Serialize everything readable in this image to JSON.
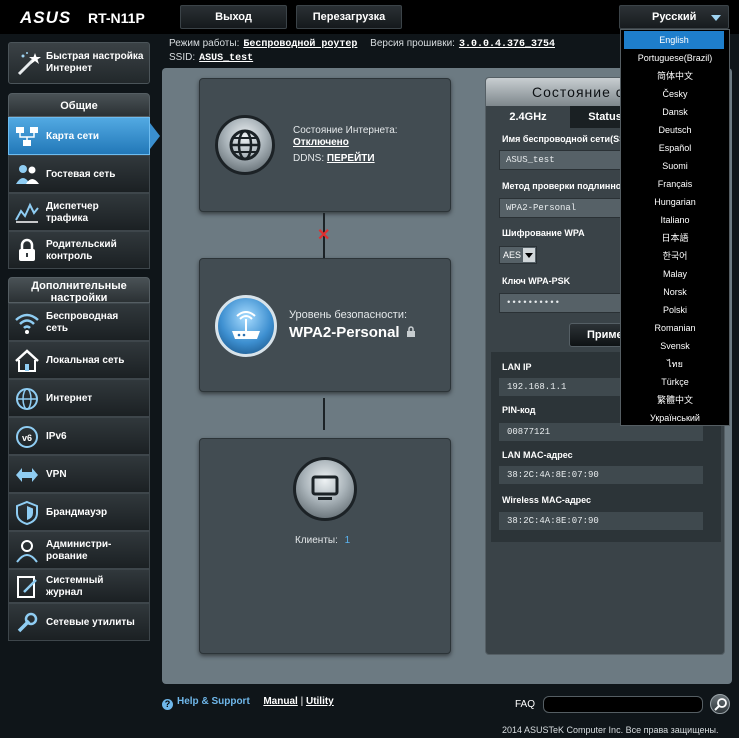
{
  "header": {
    "brand": "ASUS",
    "model": "RT-N11P",
    "logout_label": "Выход",
    "reboot_label": "Перезагрузка",
    "language_selected": "Русский"
  },
  "info": {
    "mode_label": "Режим работы:",
    "mode_value": "Беспроводной роутер",
    "firmware_label": "Версия прошивки:",
    "firmware_value": "3.0.0.4.376_3754",
    "ssid_label": "SSID:",
    "ssid_value": "ASUS_test"
  },
  "sidebar": {
    "quick_setup_line1": "Быстрая настройка",
    "quick_setup_line2": "Интернет",
    "general_header": "Общие",
    "general_items": [
      {
        "label1": "Карта сети",
        "label2": ""
      },
      {
        "label1": "Гостевая сеть",
        "label2": ""
      },
      {
        "label1": "Диспетчер",
        "label2": "трафика"
      },
      {
        "label1": "Родительский",
        "label2": "контроль"
      }
    ],
    "advanced_header_line1": "Дополнительные",
    "advanced_header_line2": "настройки",
    "advanced_items": [
      {
        "label1": "Беспроводная",
        "label2": "сеть"
      },
      {
        "label1": "Локальная сеть",
        "label2": ""
      },
      {
        "label1": "Интернет",
        "label2": ""
      },
      {
        "label1": "IPv6",
        "label2": ""
      },
      {
        "label1": "VPN",
        "label2": ""
      },
      {
        "label1": "Брандмауэр",
        "label2": ""
      },
      {
        "label1": "Администри-",
        "label2": "рование"
      },
      {
        "label1": "Системный",
        "label2": "журнал"
      },
      {
        "label1": "Сетевые утилиты",
        "label2": ""
      }
    ]
  },
  "map": {
    "internet_status_label": "Состояние Интернета:",
    "internet_status_value": "Отключено",
    "ddns_label": "DDNS:",
    "ddns_link": "ПЕРЕЙТИ",
    "security_label": "Уровень безопасности:",
    "security_value": "WPA2-Personal",
    "clients_label": "Клиенты:",
    "clients_count": "1"
  },
  "status": {
    "title": "Состояние с",
    "tab_24": "2.4GHz",
    "tab_status": "Status",
    "ssid_label": "Имя беспроводной сети(SS",
    "ssid_value": "ASUS_test",
    "auth_label": "Метод проверки подлинно",
    "auth_value": "WPA2-Personal",
    "enc_label": "Шифрование WPA",
    "enc_value": "AES",
    "psk_label": "Ключ WPA-PSK",
    "psk_value": "••••••••••",
    "apply_label": "Примен",
    "lan_ip_label": "LAN IP",
    "lan_ip_value": "192.168.1.1",
    "pin_label": "PIN-код",
    "pin_value": "00877121",
    "lan_mac_label": "LAN MAC-адрес",
    "lan_mac_value": "38:2C:4A:8E:07:90",
    "wl_mac_label": "Wireless MAC-адрес",
    "wl_mac_value": "38:2C:4A:8E:07:90"
  },
  "languages": [
    "English",
    "Portuguese(Brazil)",
    "简体中文",
    "Česky",
    "Dansk",
    "Deutsch",
    "Español",
    "Suomi",
    "Français",
    "Hungarian",
    "Italiano",
    "日本語",
    "한국어",
    "Malay",
    "Norsk",
    "Polski",
    "Romanian",
    "Svensk",
    "ไทย",
    "Türkçe",
    "繁體中文",
    "Український"
  ],
  "footer": {
    "help_label": "Help & Support",
    "manual_label": "Manual",
    "separator": "|",
    "utility_label": "Utility",
    "faq_label": "FAQ",
    "copyright": "2014  ASUSTeK Computer Inc. Все права защищены."
  },
  "colors": {
    "accent": "#2a86c8",
    "highlight": "#1e7ecb",
    "error": "#e03030"
  }
}
